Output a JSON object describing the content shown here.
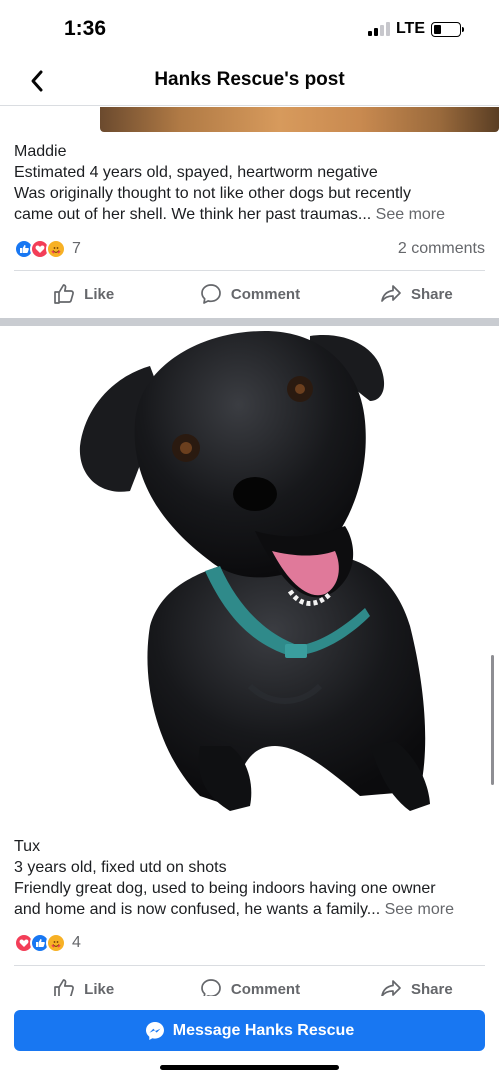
{
  "status": {
    "time": "1:36",
    "network": "LTE"
  },
  "header": {
    "title": "Hanks Rescue's post"
  },
  "posts": [
    {
      "name": "Maddie",
      "line1": "Estimated 4 years old, spayed, heartworm negative",
      "line2": "Was originally thought to not like other dogs but recently",
      "line3": "came out of her shell. We think her past traumas...",
      "see_more": "See more",
      "reaction_count": "7",
      "comments": "2 comments"
    },
    {
      "name": "Tux",
      "line1": "3 years old, fixed utd on shots",
      "line2": "Friendly great dog, used to being indoors having one owner",
      "line3": "and home and is now confused, he wants a family...",
      "see_more": "See more",
      "reaction_count": "4"
    }
  ],
  "actions": {
    "like": "Like",
    "comment": "Comment",
    "share": "Share"
  },
  "message_button": {
    "label": "Message Hanks Rescue"
  },
  "colors": {
    "brand_blue": "#1877f2",
    "love_red": "#f33e58",
    "care_yellow": "#f7b125",
    "muted": "#65676b"
  }
}
